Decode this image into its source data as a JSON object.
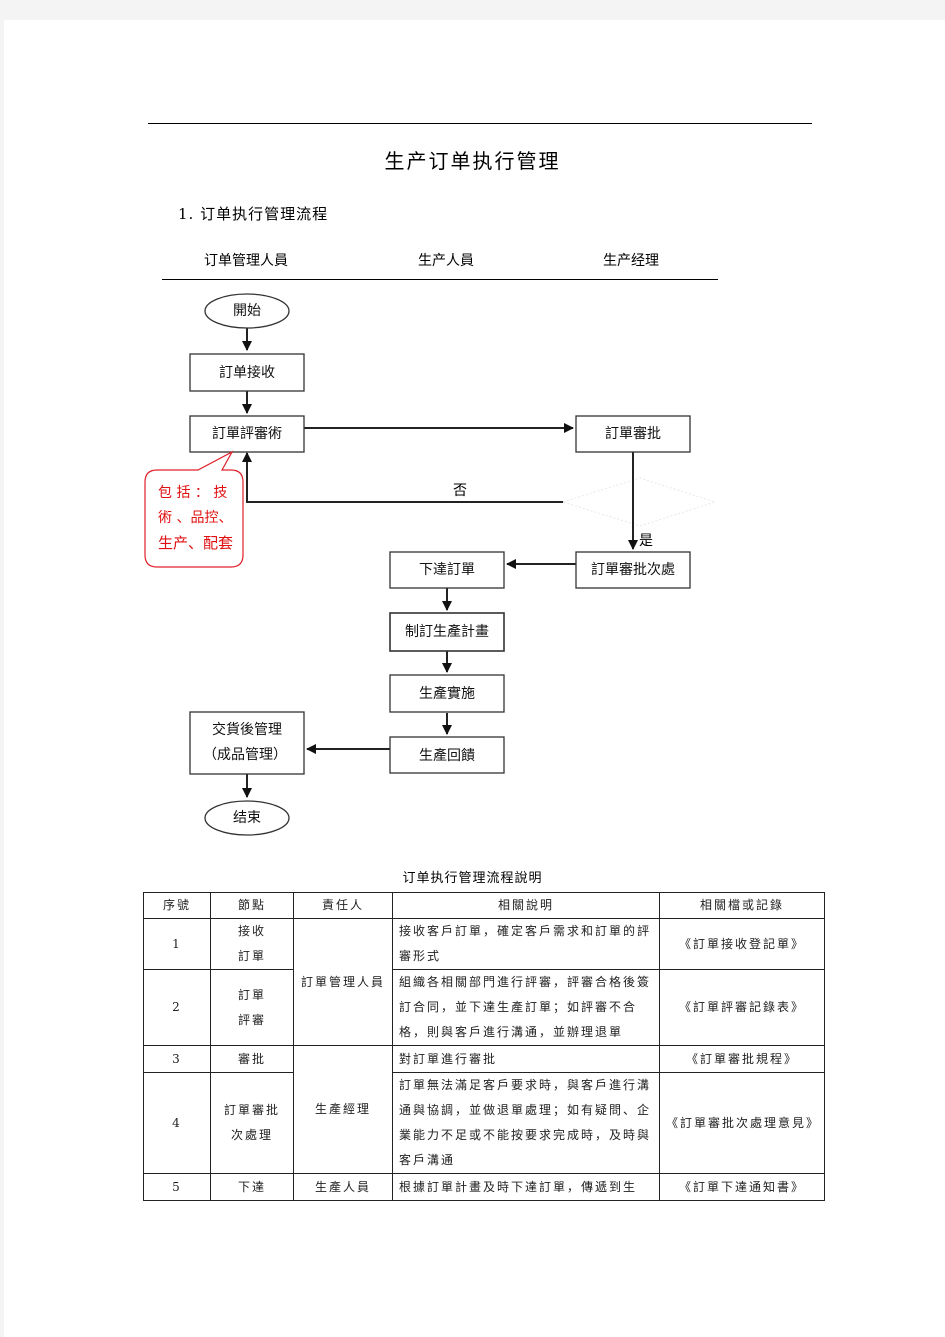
{
  "document": {
    "title": "生产订单执行管理",
    "section_title": "1. 订单执行管理流程",
    "lanes": [
      "订单管理人員",
      "生产人員",
      "生产经理"
    ]
  },
  "flowchart": {
    "nodes": {
      "start": "開始",
      "receive": "訂单接收",
      "review": "訂單評審術",
      "approve": "訂單審批",
      "approve_handle": "訂單審批次處",
      "issue": "下達訂單",
      "plan": "制訂生產計畫",
      "execute": "生產實施",
      "feedback": "生產回饋",
      "delivery_line1": "交貨後管理",
      "delivery_line2": "（成品管理）",
      "end": "结束"
    },
    "labels": {
      "no": "否",
      "yes": "是"
    },
    "callout": {
      "lines": [
        "包 括 ： 技",
        "術 、品控、",
        "生产、配套"
      ],
      "color": "#e01010"
    }
  },
  "table": {
    "caption": "订单执行管理流程說明",
    "headers": [
      "序號",
      "節點",
      "責任人",
      "相關說明",
      "相關檔或記錄"
    ],
    "rows": [
      {
        "no": "1",
        "node": [
          "接收",
          "訂單"
        ],
        "owner": "訂單管理人員",
        "desc": "接收客戶訂單，確定客戶需求和訂單的評審形式",
        "record": "《訂單接收登記單》"
      },
      {
        "no": "2",
        "node": [
          "訂單",
          "評審"
        ],
        "owner": "",
        "desc": "組織各相關部門進行評審，評審合格後簽訂合同，並下達生產訂單；如評審不合格，則與客戶進行溝通，並辦理退單",
        "record": "《訂單評審記錄表》"
      },
      {
        "no": "3",
        "node": [
          "審批"
        ],
        "owner": "生產經理",
        "desc": "對訂單進行審批",
        "record": "《訂單審批規程》"
      },
      {
        "no": "4",
        "node": [
          "訂單審批",
          "次處理"
        ],
        "owner": "",
        "desc": "訂單無法滿足客戶要求時，與客戶進行溝通與協調，並做退單處理；如有疑問、企業能力不足或不能按要求完成時，及時與客戶溝通",
        "record": "《訂單審批次處理意見》"
      },
      {
        "no": "5",
        "node": [
          "下達"
        ],
        "owner": "生產人員",
        "desc": "根據訂單計畫及時下達訂單，傳遞到生",
        "record": "《訂單下達通知書》"
      }
    ]
  }
}
